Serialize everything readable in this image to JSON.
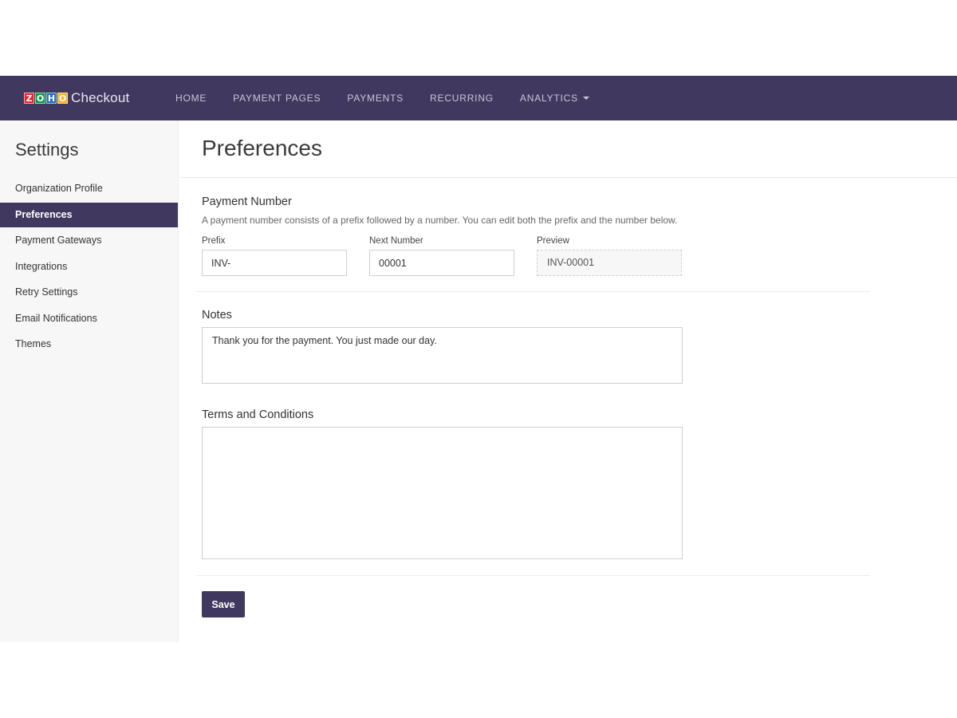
{
  "header": {
    "logo_letters": [
      "Z",
      "O",
      "H",
      "O"
    ],
    "logo_colors": [
      "#e42527",
      "#089949",
      "#226db4",
      "#f9b21d"
    ],
    "brand": "Checkout",
    "nav": [
      {
        "label": "HOME"
      },
      {
        "label": "PAYMENT PAGES"
      },
      {
        "label": "PAYMENTS"
      },
      {
        "label": "RECURRING"
      },
      {
        "label": "ANALYTICS",
        "icon": "caret-down-icon"
      }
    ],
    "accent": "#40385f"
  },
  "sidebar": {
    "title": "Settings",
    "items": [
      {
        "label": "Organization Profile",
        "active": false
      },
      {
        "label": "Preferences",
        "active": true
      },
      {
        "label": "Payment Gateways",
        "active": false
      },
      {
        "label": "Integrations",
        "active": false
      },
      {
        "label": "Retry Settings",
        "active": false
      },
      {
        "label": "Email Notifications",
        "active": false
      },
      {
        "label": "Themes",
        "active": false
      }
    ]
  },
  "main": {
    "title": "Preferences",
    "payment_number": {
      "label": "Payment Number",
      "helper": "A payment number consists of a prefix followed by a number. You can edit both the prefix and the number below.",
      "prefix_label": "Prefix",
      "prefix_value": "INV-",
      "next_label": "Next Number",
      "next_value": "00001",
      "preview_label": "Preview",
      "preview_value": "INV-00001"
    },
    "notes": {
      "label": "Notes",
      "value": "Thank you for the payment. You just made our day."
    },
    "terms": {
      "label": "Terms and Conditions",
      "value": ""
    },
    "save_label": "Save"
  }
}
